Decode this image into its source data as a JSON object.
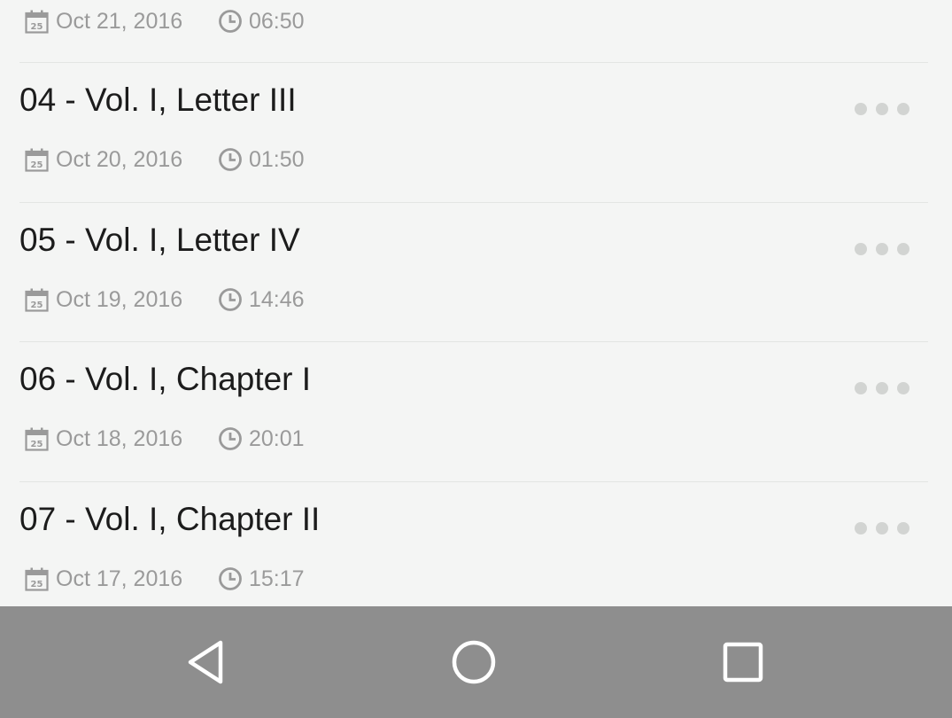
{
  "episodes": [
    {
      "title": "",
      "date": "Oct 21, 2016",
      "duration": "06:50"
    },
    {
      "title": "04 - Vol. I, Letter III",
      "date": "Oct 20, 2016",
      "duration": "01:50"
    },
    {
      "title": "05 - Vol. I, Letter IV",
      "date": "Oct 19, 2016",
      "duration": "14:46"
    },
    {
      "title": "06 - Vol. I, Chapter I",
      "date": "Oct 18, 2016",
      "duration": "20:01"
    },
    {
      "title": "07 - Vol. I, Chapter II",
      "date": "Oct 17, 2016",
      "duration": "15:17"
    }
  ],
  "calendar_icon_day": "25",
  "icons": {
    "date": "calendar-icon",
    "duration": "clock-icon",
    "more": "more-options-icon",
    "nav_back": "back-triangle-icon",
    "nav_home": "home-circle-icon",
    "nav_recents": "recents-square-icon"
  },
  "colors": {
    "background": "#f4f5f4",
    "title_text": "#1c1c1c",
    "meta_text": "#9a9a9a",
    "divider": "#e3e5e3",
    "more_dots": "#d2d4d2",
    "navbar": "#8e8e8e",
    "nav_icons": "#ffffff"
  }
}
